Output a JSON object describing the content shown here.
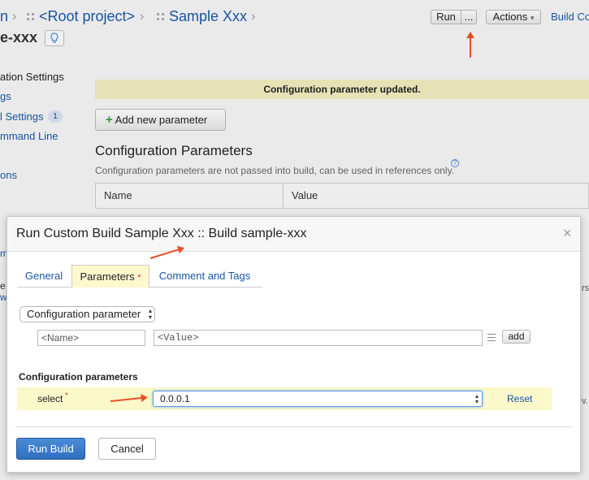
{
  "breadcrumb": {
    "partial_left": "n",
    "root": "<Root project>",
    "project": "Sample Xxx",
    "sep": "›"
  },
  "build_title_partial": "e-xxx",
  "toolbar": {
    "run": "Run",
    "more": "...",
    "actions": "Actions",
    "actions_caret": "▾",
    "build_config_partial": "Build Co"
  },
  "sidebar": {
    "items": [
      {
        "label": "ation Settings"
      },
      {
        "label": "gs"
      },
      {
        "label": "l Settings",
        "badge": "1"
      },
      {
        "label": "mmand Line"
      },
      {
        "label": "ons"
      }
    ],
    "partial_behind_dialog": [
      "m",
      "e",
      "w"
    ]
  },
  "banner": "Configuration parameter updated.",
  "add_param_button": {
    "icon": "+",
    "label": "Add new parameter"
  },
  "config_heading": "Configuration Parameters",
  "config_note": "Configuration parameters are not passed into build, can be used in references only.",
  "help_icon": "?",
  "table": {
    "headers": [
      "Name",
      "Value"
    ]
  },
  "right_partial": [
    "rs",
    "v."
  ],
  "dialog": {
    "title": "Run Custom Build Sample Xxx :: Build sample-xxx",
    "close": "×",
    "tabs": [
      {
        "label": "General"
      },
      {
        "label": "Parameters",
        "required_mark": "*"
      },
      {
        "label": "Comment and Tags"
      }
    ],
    "param_type_select": "Configuration parameter",
    "name_placeholder": "<Name>",
    "value_placeholder": "<Value>",
    "add_label": "add",
    "section_heading": "Configuration parameters",
    "param_row": {
      "name": "select",
      "required_mark": "*",
      "value": "0.0.0.1",
      "reset": "Reset"
    },
    "run_build": "Run Build",
    "cancel": "Cancel"
  },
  "colors": {
    "link": "#1a56a7",
    "banner_bg": "#eeeabb",
    "primary_button": "#2f6fbe",
    "annotation_arrow": "#e8502a",
    "required_mark": "#d9342b"
  }
}
